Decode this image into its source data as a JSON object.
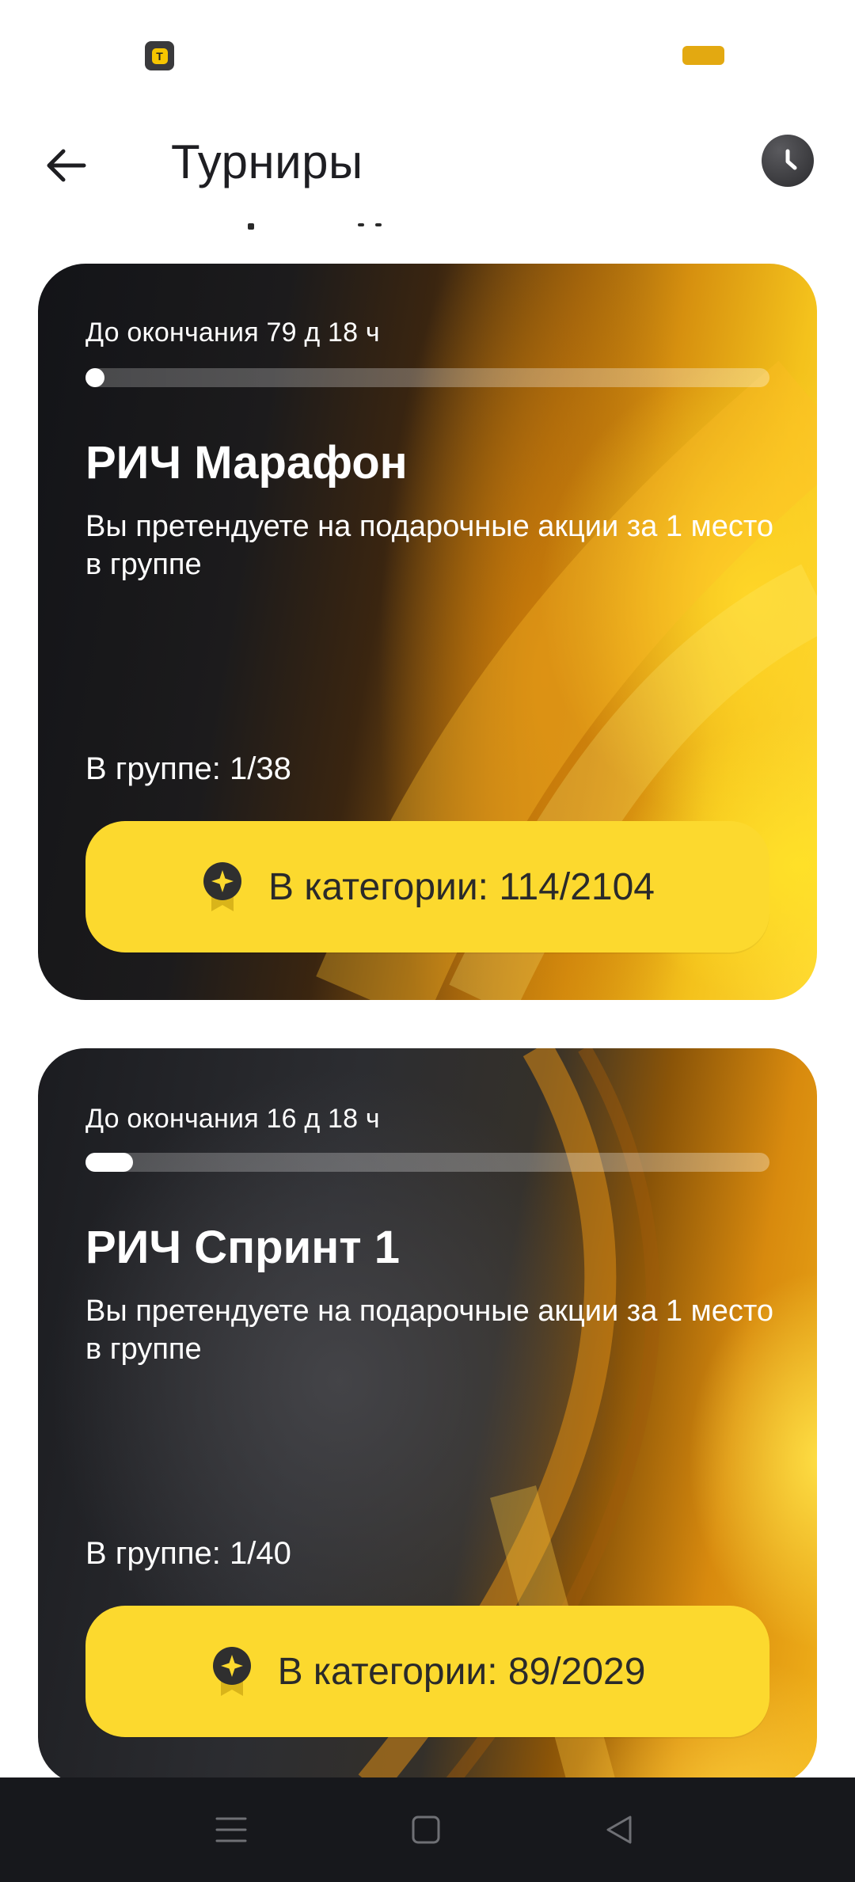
{
  "status_bar": {
    "notification_icon": "app-logo-icon",
    "notification_glyph": "T",
    "battery_color": "#e3a911"
  },
  "header": {
    "title": "Турниры",
    "back_icon": "arrow-left-icon",
    "history_icon": "clock-icon"
  },
  "tournaments": [
    {
      "timer": "До окончания 79 д 18 ч",
      "progress": 0.02,
      "title": "РИЧ Марафон",
      "description": "Вы претендуете на подарочные акции за 1 место в группе",
      "group": "В группе: 1/38",
      "category_label": "В категории: 114/2104",
      "category_icon": "medal-star-icon"
    },
    {
      "timer": "До окончания 16 д 18 ч",
      "progress": 0.07,
      "title": "РИЧ Спринт 1",
      "description": "Вы претендуете на подарочные акции за 1 место в группе",
      "group": "В группе: 1/40",
      "category_label": "В категории: 89/2029",
      "category_icon": "medal-star-icon"
    }
  ],
  "colors": {
    "accent_yellow": "#fcd92e",
    "card_dark": "#131418",
    "nav_bar": "#17181c"
  },
  "nav_bar": {
    "items": [
      "menu-icon",
      "home-square-icon",
      "back-triangle-icon"
    ]
  }
}
